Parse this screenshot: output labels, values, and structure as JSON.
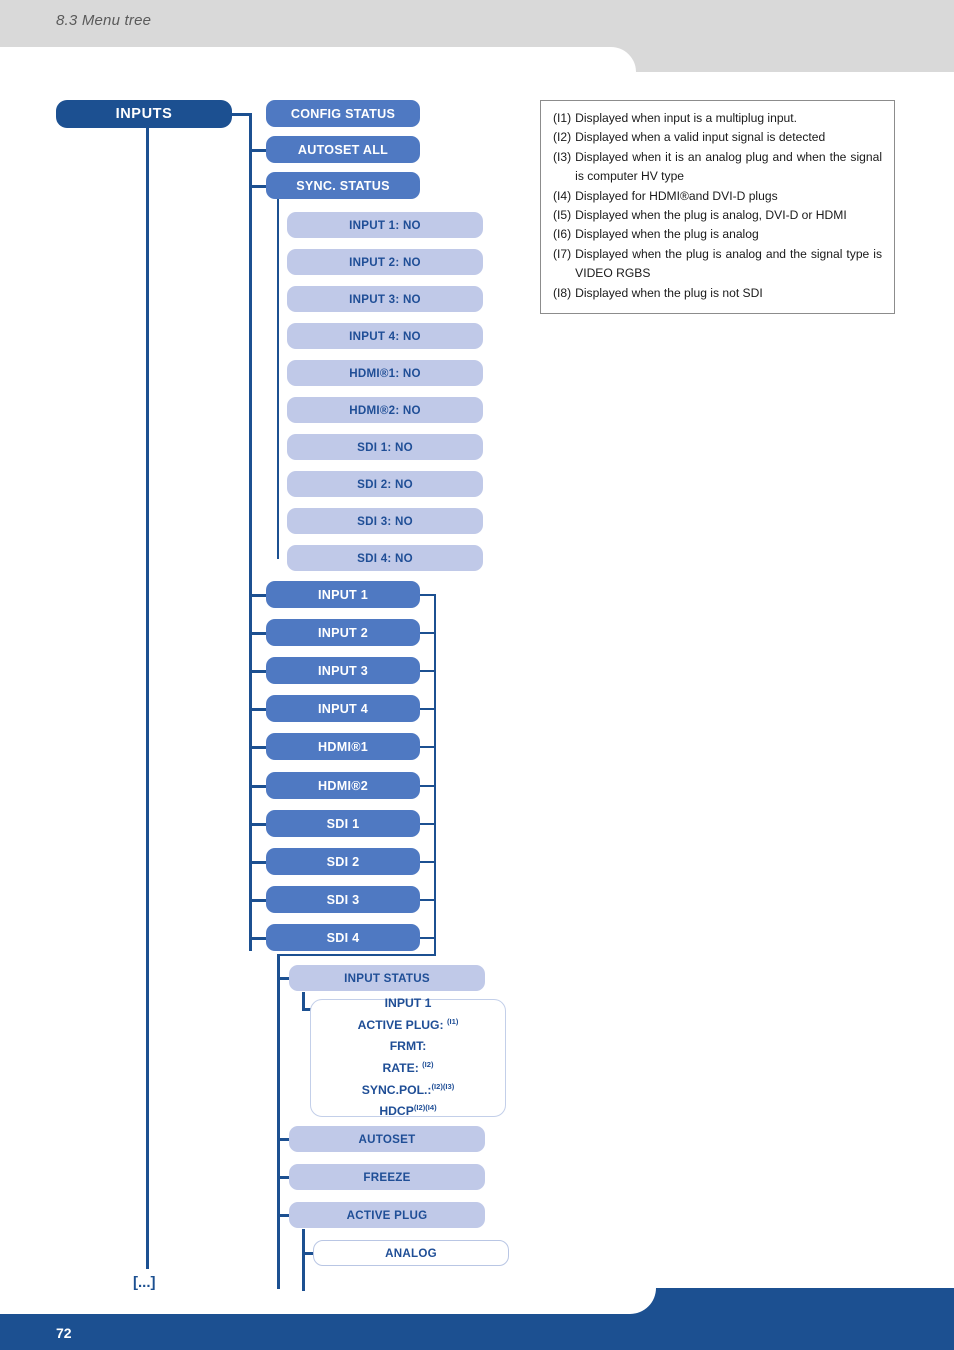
{
  "header": {
    "section_title": "8.3 Menu tree"
  },
  "footer": {
    "page_number": "72"
  },
  "colors": {
    "navy": "#1C5091",
    "medium_blue": "#4F79C2",
    "light_blue": "#C0C9E8",
    "header_gray": "#D9D9D9",
    "label_blue": "#1F4E96"
  },
  "tree": {
    "root": "INPUTS",
    "continuation_marker": "[...]",
    "level2": [
      "CONFIG STATUS",
      "AUTOSET ALL",
      "SYNC. STATUS"
    ],
    "sync_status_items": [
      "INPUT 1: NO",
      "INPUT 2: NO",
      "INPUT 3: NO",
      "INPUT 4: NO",
      "HDMI®1: NO",
      "HDMI®2: NO",
      "SDI 1: NO",
      "SDI 2: NO",
      "SDI 3: NO",
      "SDI 4: NO"
    ],
    "input_nodes": [
      "INPUT 1",
      "INPUT 2",
      "INPUT 3",
      "INPUT 4",
      "HDMI®1",
      "HDMI®2",
      "SDI 1",
      "SDI 2",
      "SDI 3",
      "SDI 4"
    ],
    "input_submenu": [
      "INPUT STATUS",
      "AUTOSET",
      "FREEZE",
      "ACTIVE PLUG"
    ],
    "active_plug_value": "ANALOG",
    "input_status_detail": {
      "title": "INPUT 1",
      "rows": [
        {
          "label": "ACTIVE PLUG: ",
          "notes": "(I1)"
        },
        {
          "label": "FRMT:",
          "notes": ""
        },
        {
          "label": "RATE: ",
          "notes": "(I2)"
        },
        {
          "label": "SYNC.POL.:",
          "notes": "(I2)(I3)"
        },
        {
          "label": "HDCP",
          "notes": "(I2)(I4)"
        }
      ]
    }
  },
  "legend": {
    "items": [
      {
        "tag": "(I1)",
        "text": "Displayed when input is a multiplug input."
      },
      {
        "tag": "(I2)",
        "text": "Displayed when a valid input signal is detected"
      },
      {
        "tag": "(I3)",
        "text": "Displayed when it is an analog plug and when the signal is computer HV type"
      },
      {
        "tag": "(I4)",
        "text": "Displayed for HDMI®and DVI-D plugs"
      },
      {
        "tag": "(I5)",
        "text": "Displayed when the plug is analog, DVI-D or HDMI"
      },
      {
        "tag": "(I6)",
        "text": "Displayed when the plug is analog"
      },
      {
        "tag": "(I7)",
        "text": "Displayed when the plug is analog and the signal type is VIDEO RGBS"
      },
      {
        "tag": "(I8)",
        "text": "Displayed when the plug is not SDI"
      }
    ]
  }
}
